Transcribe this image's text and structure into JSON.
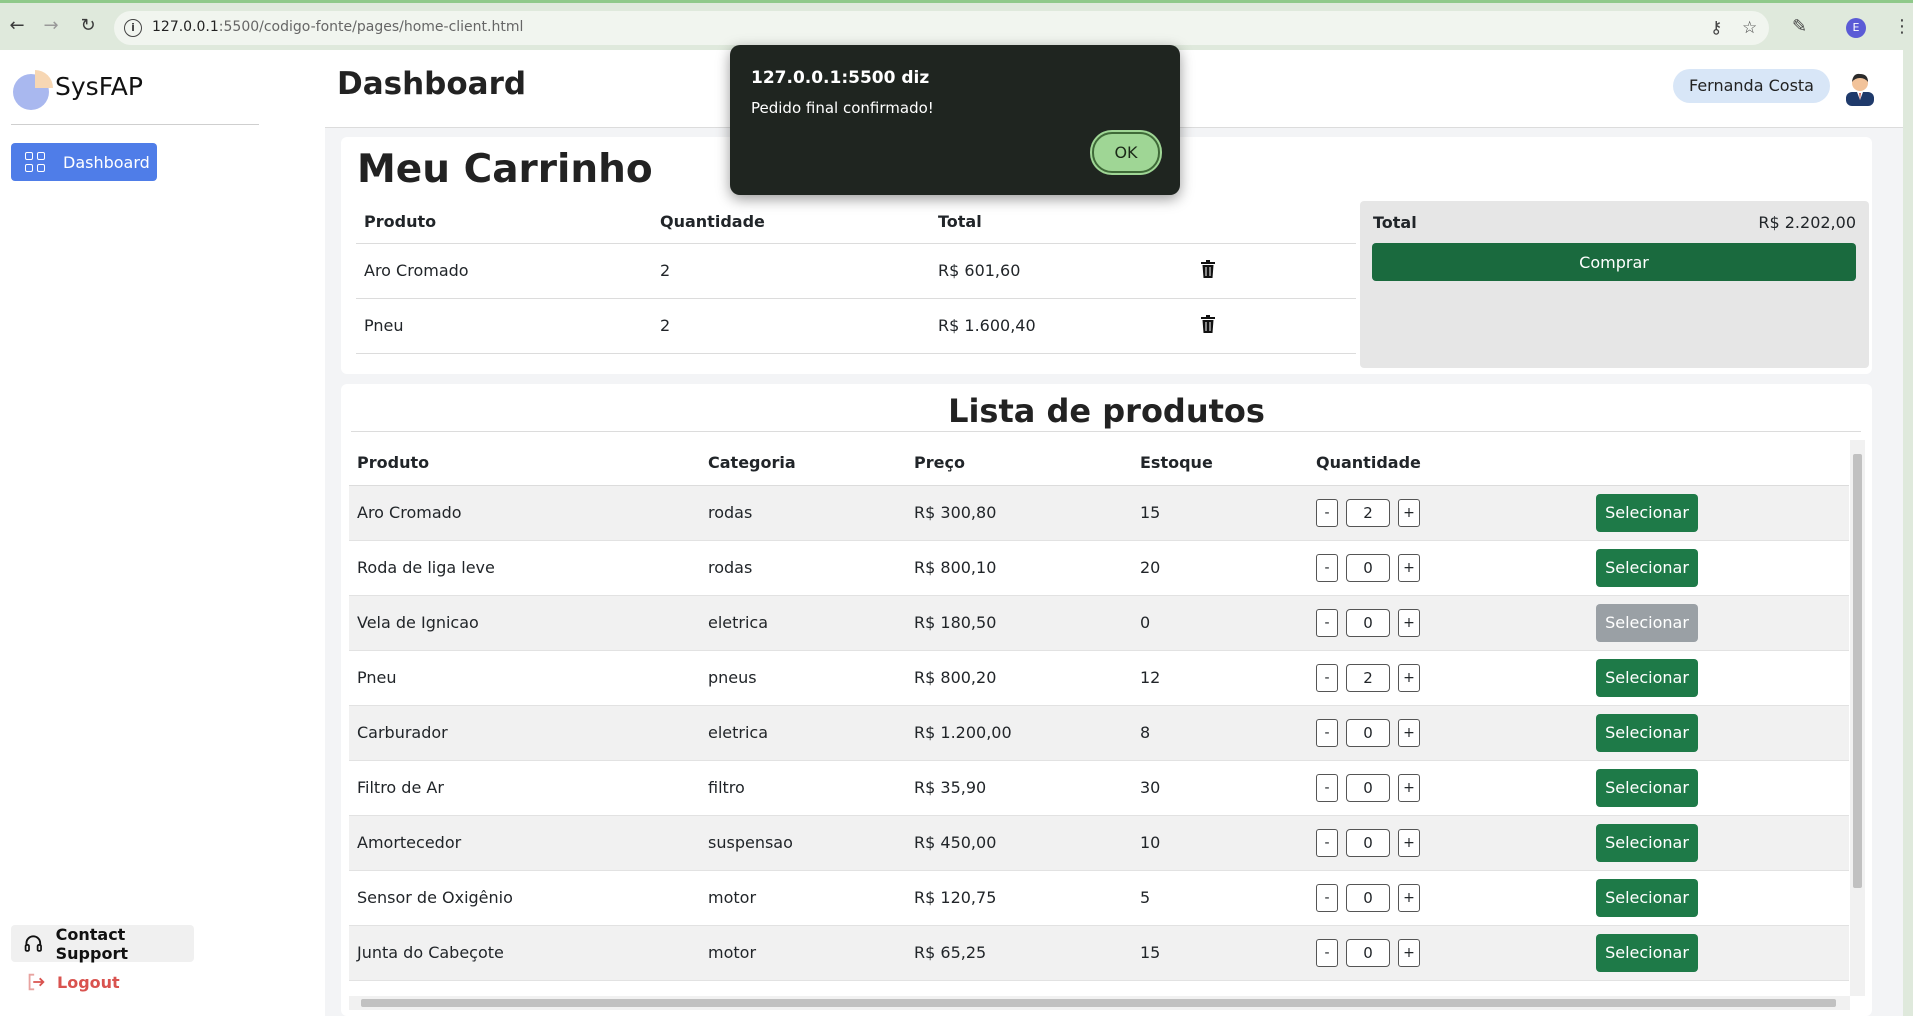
{
  "browser": {
    "url_host": "127.0.0.1",
    "url_rest": ":5500/codigo-fonte/pages/home-client.html",
    "profile_initial": "E"
  },
  "sidebar": {
    "brand": "SysFAP",
    "nav_items": [
      {
        "label": "Dashboard",
        "icon": "grid-icon",
        "active": true
      }
    ],
    "contact_support": "Contact Support",
    "logout": "Logout"
  },
  "header": {
    "title": "Dashboard",
    "user_name": "Fernanda Costa"
  },
  "cart": {
    "title": "Meu Carrinho",
    "columns": [
      "Produto",
      "Quantidade",
      "Total"
    ],
    "rows": [
      {
        "produto": "Aro Cromado",
        "quantidade": "2",
        "total": "R$ 601,60"
      },
      {
        "produto": "Pneu",
        "quantidade": "2",
        "total": "R$ 1.600,40"
      }
    ],
    "summary": {
      "total_label": "Total",
      "total_value": "R$ 2.202,00",
      "buy_label": "Comprar"
    }
  },
  "products": {
    "title": "Lista de produtos",
    "columns": [
      "Produto",
      "Categoria",
      "Preço",
      "Estoque",
      "Quantidade"
    ],
    "select_label": "Selecionar",
    "rows": [
      {
        "produto": "Aro Cromado",
        "categoria": "rodas",
        "preco": "R$ 300,80",
        "estoque": "15",
        "quantidade": "2",
        "enabled": true
      },
      {
        "produto": "Roda de liga leve",
        "categoria": "rodas",
        "preco": "R$ 800,10",
        "estoque": "20",
        "quantidade": "0",
        "enabled": true
      },
      {
        "produto": "Vela de Ignicao",
        "categoria": "eletrica",
        "preco": "R$ 180,50",
        "estoque": "0",
        "quantidade": "0",
        "enabled": false
      },
      {
        "produto": "Pneu",
        "categoria": "pneus",
        "preco": "R$ 800,20",
        "estoque": "12",
        "quantidade": "2",
        "enabled": true
      },
      {
        "produto": "Carburador",
        "categoria": "eletrica",
        "preco": "R$ 1.200,00",
        "estoque": "8",
        "quantidade": "0",
        "enabled": true
      },
      {
        "produto": "Filtro de Ar",
        "categoria": "filtro",
        "preco": "R$ 35,90",
        "estoque": "30",
        "quantidade": "0",
        "enabled": true
      },
      {
        "produto": "Amortecedor",
        "categoria": "suspensao",
        "preco": "R$ 450,00",
        "estoque": "10",
        "quantidade": "0",
        "enabled": true
      },
      {
        "produto": "Sensor de Oxigênio",
        "categoria": "motor",
        "preco": "R$ 120,75",
        "estoque": "5",
        "quantidade": "0",
        "enabled": true
      },
      {
        "produto": "Junta do Cabeçote",
        "categoria": "motor",
        "preco": "R$ 65,25",
        "estoque": "15",
        "quantidade": "0",
        "enabled": true
      }
    ]
  },
  "alert": {
    "title": "127.0.0.1:5500 diz",
    "message": "Pedido final confirmado!",
    "ok_label": "OK"
  },
  "colors": {
    "accent_blue": "#4f7de8",
    "buy_green": "#1a6a3e",
    "select_green": "#1e7a48",
    "disabled_gray": "#9aa0a5",
    "logout_red": "#d9534f"
  }
}
